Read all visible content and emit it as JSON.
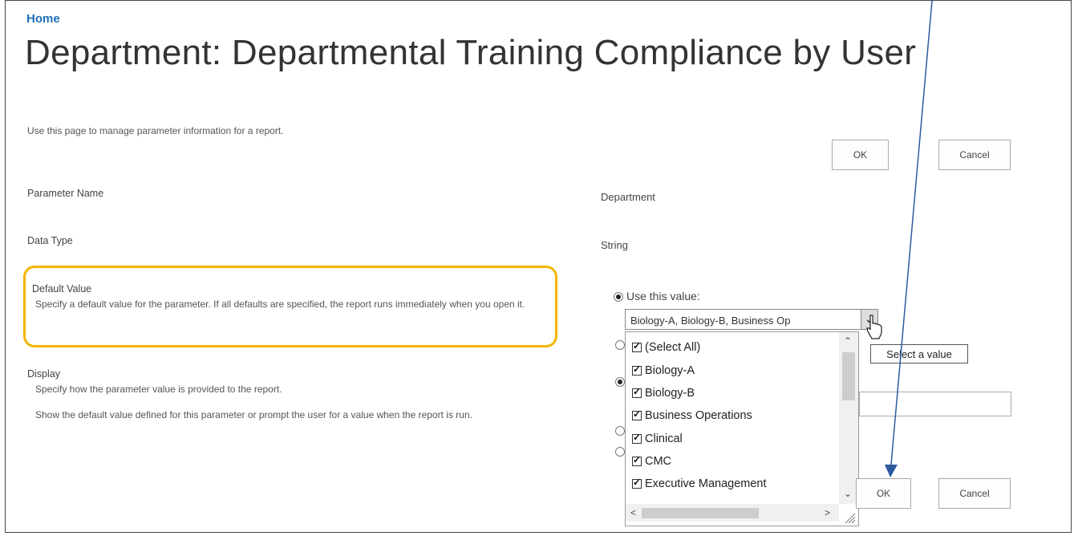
{
  "breadcrumb": {
    "home": "Home"
  },
  "page": {
    "title": "Department: Departmental Training Compliance by User",
    "intro": "Use this page to manage parameter information for a report."
  },
  "top_buttons": {
    "ok": "OK",
    "cancel": "Cancel"
  },
  "bottom_buttons": {
    "ok": "OK",
    "cancel": "Cancel"
  },
  "fields": {
    "parameter_name": {
      "label": "Parameter Name",
      "value": "Department"
    },
    "data_type": {
      "label": "Data Type",
      "value": "String"
    },
    "default_value": {
      "label": "Default Value",
      "description": "Specify a default value for the parameter. If all defaults are specified, the report runs immediately when you open it.",
      "option_use_value": "Use this value:",
      "combo_value": "Biology-A, Biology-B, Business Op"
    },
    "display": {
      "label": "Display",
      "description1": "Specify how the parameter value is provided to the report.",
      "description2": "Show the default value defined for this parameter or prompt the user for a value when the report is run."
    }
  },
  "dropdown": {
    "items": [
      "(Select All)",
      "Biology-A",
      "Biology-B",
      "Business Operations",
      "Clinical",
      "CMC",
      "Executive Management"
    ],
    "checked": true
  },
  "tooltip": "Select a value",
  "colors": {
    "link": "#1e6fb8",
    "highlight": "#f2b600",
    "arrow": "#2c5aa0"
  }
}
